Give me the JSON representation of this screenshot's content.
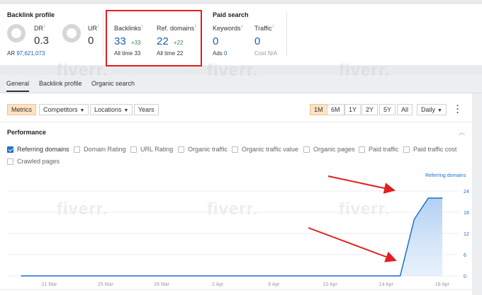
{
  "backlink_profile": {
    "title": "Backlink profile",
    "dr": {
      "label": "DR",
      "info": "i",
      "value": "0.3"
    },
    "ur": {
      "label": "UR",
      "info": "i",
      "value": "0"
    },
    "ar_label": "AR",
    "ar_value": "97,621,073",
    "backlinks": {
      "label": "Backlinks",
      "info": "i",
      "value": "33",
      "delta": "+33",
      "all_time_label": "All time",
      "all_time_value": "33"
    },
    "ref_domains": {
      "label": "Ref. domains",
      "info": "i",
      "value": "22",
      "delta": "+22",
      "all_time_label": "All time",
      "all_time_value": "22"
    }
  },
  "paid_search": {
    "title": "Paid search",
    "keywords": {
      "label": "Keywords",
      "info": "i",
      "value": "0",
      "sub_label": "Ads",
      "sub_value": "0"
    },
    "traffic": {
      "label": "Traffic",
      "info": "i",
      "value": "0",
      "sub_label": "Cost",
      "sub_value": "N/A"
    }
  },
  "tabs": [
    {
      "label": "General",
      "active": true
    },
    {
      "label": "Backlink profile",
      "active": false
    },
    {
      "label": "Organic search",
      "active": false
    }
  ],
  "toolbar": {
    "metrics": "Metrics",
    "competitors": "Competitors",
    "locations": "Locations",
    "years": "Years",
    "ranges": [
      "1M",
      "6M",
      "1Y",
      "2Y",
      "5Y",
      "All"
    ],
    "selected_range": "1M",
    "granularity": "Daily",
    "more_icon": "kebab-icon"
  },
  "performance": {
    "title": "Performance",
    "collapse_icon": "chevron-up-icon",
    "checkboxes": [
      {
        "label": "Referring domains",
        "checked": true
      },
      {
        "label": "Domain Rating",
        "checked": false
      },
      {
        "label": "URL Rating",
        "checked": false
      },
      {
        "label": "Organic traffic",
        "checked": false
      },
      {
        "label": "Organic traffic value",
        "checked": false
      },
      {
        "label": "Organic pages",
        "checked": false
      },
      {
        "label": "Paid traffic",
        "checked": false
      },
      {
        "label": "Paid traffic cost",
        "checked": false
      },
      {
        "label": "Crawled pages",
        "checked": false
      }
    ]
  },
  "watermark": "fiverr.",
  "colors": {
    "accent": "#1c6fd1",
    "highlight": "#e02020",
    "selected_btn": "#fde3c4",
    "delta": "#2e8b3a"
  },
  "chart_data": {
    "type": "area",
    "series": [
      {
        "name": "Referring domains",
        "x": [
          "19 Mar",
          "20 Mar",
          "21 Mar",
          "22 Mar",
          "23 Mar",
          "24 Mar",
          "25 Mar",
          "26 Mar",
          "27 Mar",
          "28 Mar",
          "29 Mar",
          "30 Mar",
          "31 Mar",
          "1 Apr",
          "2 Apr",
          "3 Apr",
          "4 Apr",
          "5 Apr",
          "6 Apr",
          "7 Apr",
          "8 Apr",
          "9 Apr",
          "10 Apr",
          "11 Apr",
          "12 Apr",
          "13 Apr",
          "14 Apr",
          "15 Apr",
          "16 Apr",
          "17 Apr",
          "18 Apr"
        ],
        "values": [
          0,
          0,
          0,
          0,
          0,
          0,
          0,
          0,
          0,
          0,
          0,
          0,
          0,
          0,
          0,
          0,
          0,
          0,
          0,
          0,
          0,
          0,
          0,
          0,
          0,
          0,
          0,
          0,
          16,
          22,
          22
        ]
      }
    ],
    "x_tick_labels": [
      "21 Mar",
      "25 Mar",
      "29 Mar",
      "2 Apr",
      "6 Apr",
      "10 Apr",
      "14 Apr",
      "18 Apr"
    ],
    "y_ticks": [
      "0",
      "6",
      "12",
      "18",
      "24"
    ],
    "ylim": [
      0,
      24
    ],
    "grid": true,
    "legend": "top-right"
  }
}
